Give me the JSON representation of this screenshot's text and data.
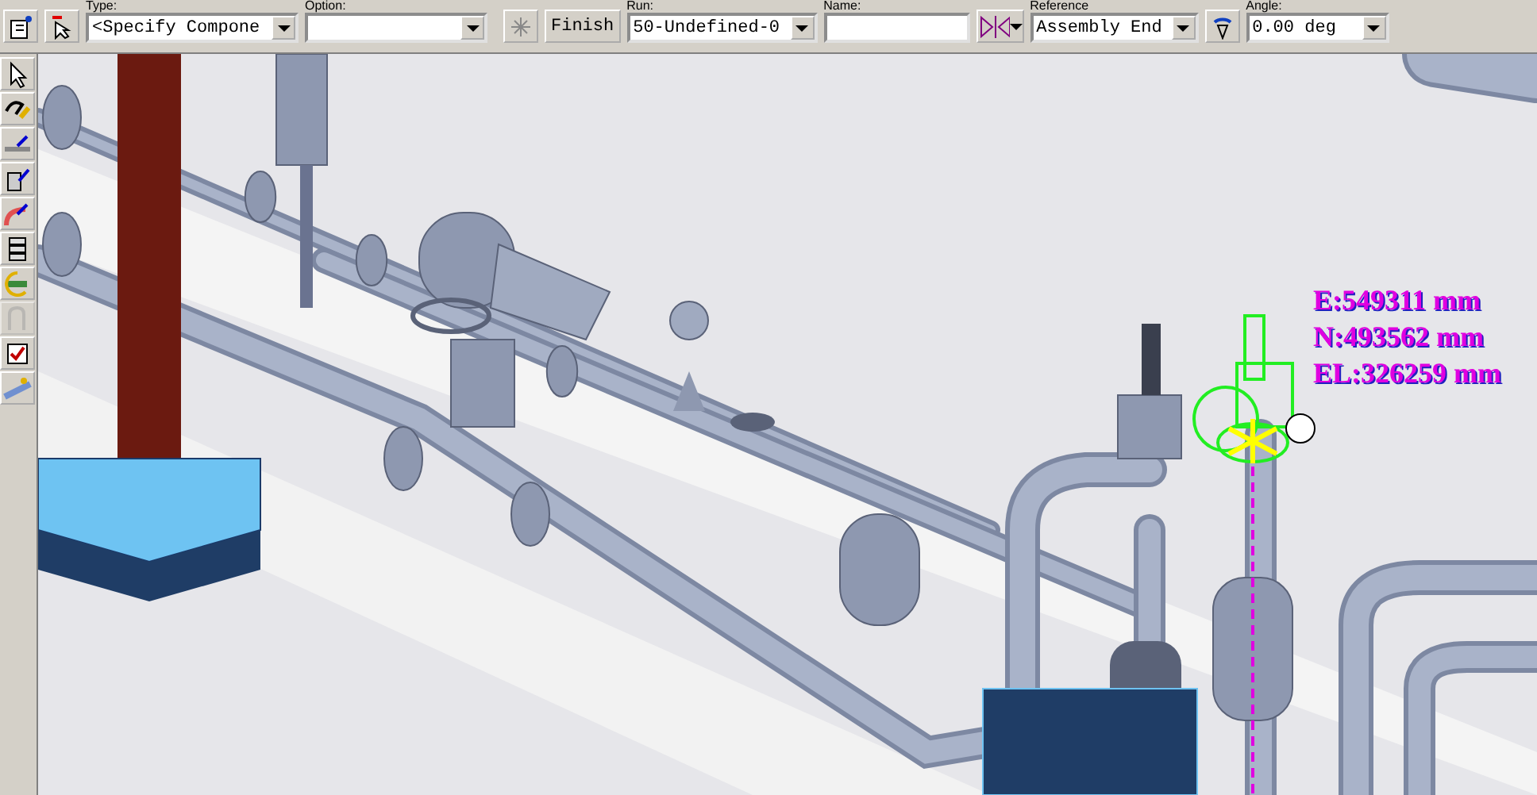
{
  "toolbar": {
    "fields": [
      {
        "kind": "combo",
        "label": "Type:",
        "value": "<Specify Compone"
      },
      {
        "kind": "combo",
        "label": "Option:"
      },
      {
        "kind": "finish",
        "text": "Finish"
      },
      {
        "kind": "combo",
        "label": "Run:",
        "value": "50-Undefined-0"
      },
      {
        "kind": "text",
        "label": "Name:"
      },
      {
        "kind": "split"
      },
      {
        "kind": "combo",
        "label": "Reference",
        "value": "Assembly End"
      },
      {
        "kind": "rotate"
      },
      {
        "kind": "combo",
        "label": "Angle:",
        "value": "0.00 deg"
      }
    ]
  },
  "tools": [
    {
      "kind": "pointer",
      "disabled": false
    },
    {
      "kind": "route",
      "disabled": false
    },
    {
      "kind": "connect",
      "disabled": false
    },
    {
      "kind": "equipment",
      "disabled": false
    },
    {
      "kind": "elbow",
      "disabled": false
    },
    {
      "kind": "stack",
      "disabled": false
    },
    {
      "kind": "rotate",
      "disabled": false
    },
    {
      "kind": "bend",
      "disabled": true
    },
    {
      "kind": "check",
      "disabled": false
    },
    {
      "kind": "sloped",
      "disabled": false
    }
  ],
  "coordinates": [
    "E:549311 mm",
    "N:493562 mm",
    "EL:326259 mm"
  ]
}
